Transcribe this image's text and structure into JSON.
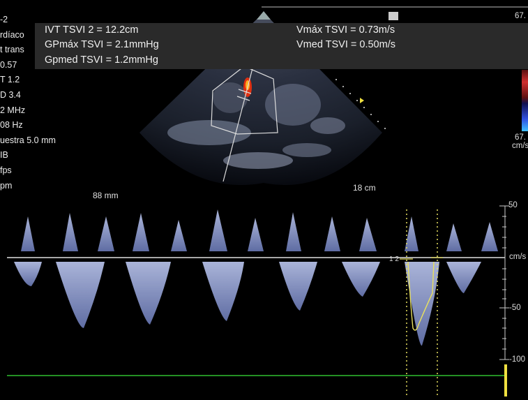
{
  "left_params": [
    "-2",
    "rdíaco",
    "t trans",
    "0.57",
    "T 1.2",
    "D 3.4",
    "2 MHz",
    "08 Hz",
    "uestra 5.0 mm",
    "IB",
    "fps",
    "pm"
  ],
  "measurements": {
    "ivt": "IVT TSVI  2 = 12.2cm",
    "gpmax": "GPmáx TSVI = 2.1mmHg",
    "gpmed": "Gpmed TSVI = 1.2mmHg",
    "vmax": "Vmáx TSVI = 0.73m/s",
    "vmed": "Vmed TSVI = 0.50m/s"
  },
  "labels": {
    "depth_small": "88 mm",
    "depth_large": "18 cm",
    "color_top": "67.",
    "color_bottom": "67.",
    "color_unit": "cm/s",
    "gate_marker": "1 2"
  },
  "doppler_scale": {
    "unit": "cm/s",
    "ticks": [
      "50",
      "-50",
      "-100"
    ]
  },
  "colors": {
    "baseline": "#e0e0e0",
    "trace": "#e8e060",
    "green_line": "#30c030",
    "caliper": "#e8e060",
    "measurement_panel": "#2a2a2a"
  }
}
